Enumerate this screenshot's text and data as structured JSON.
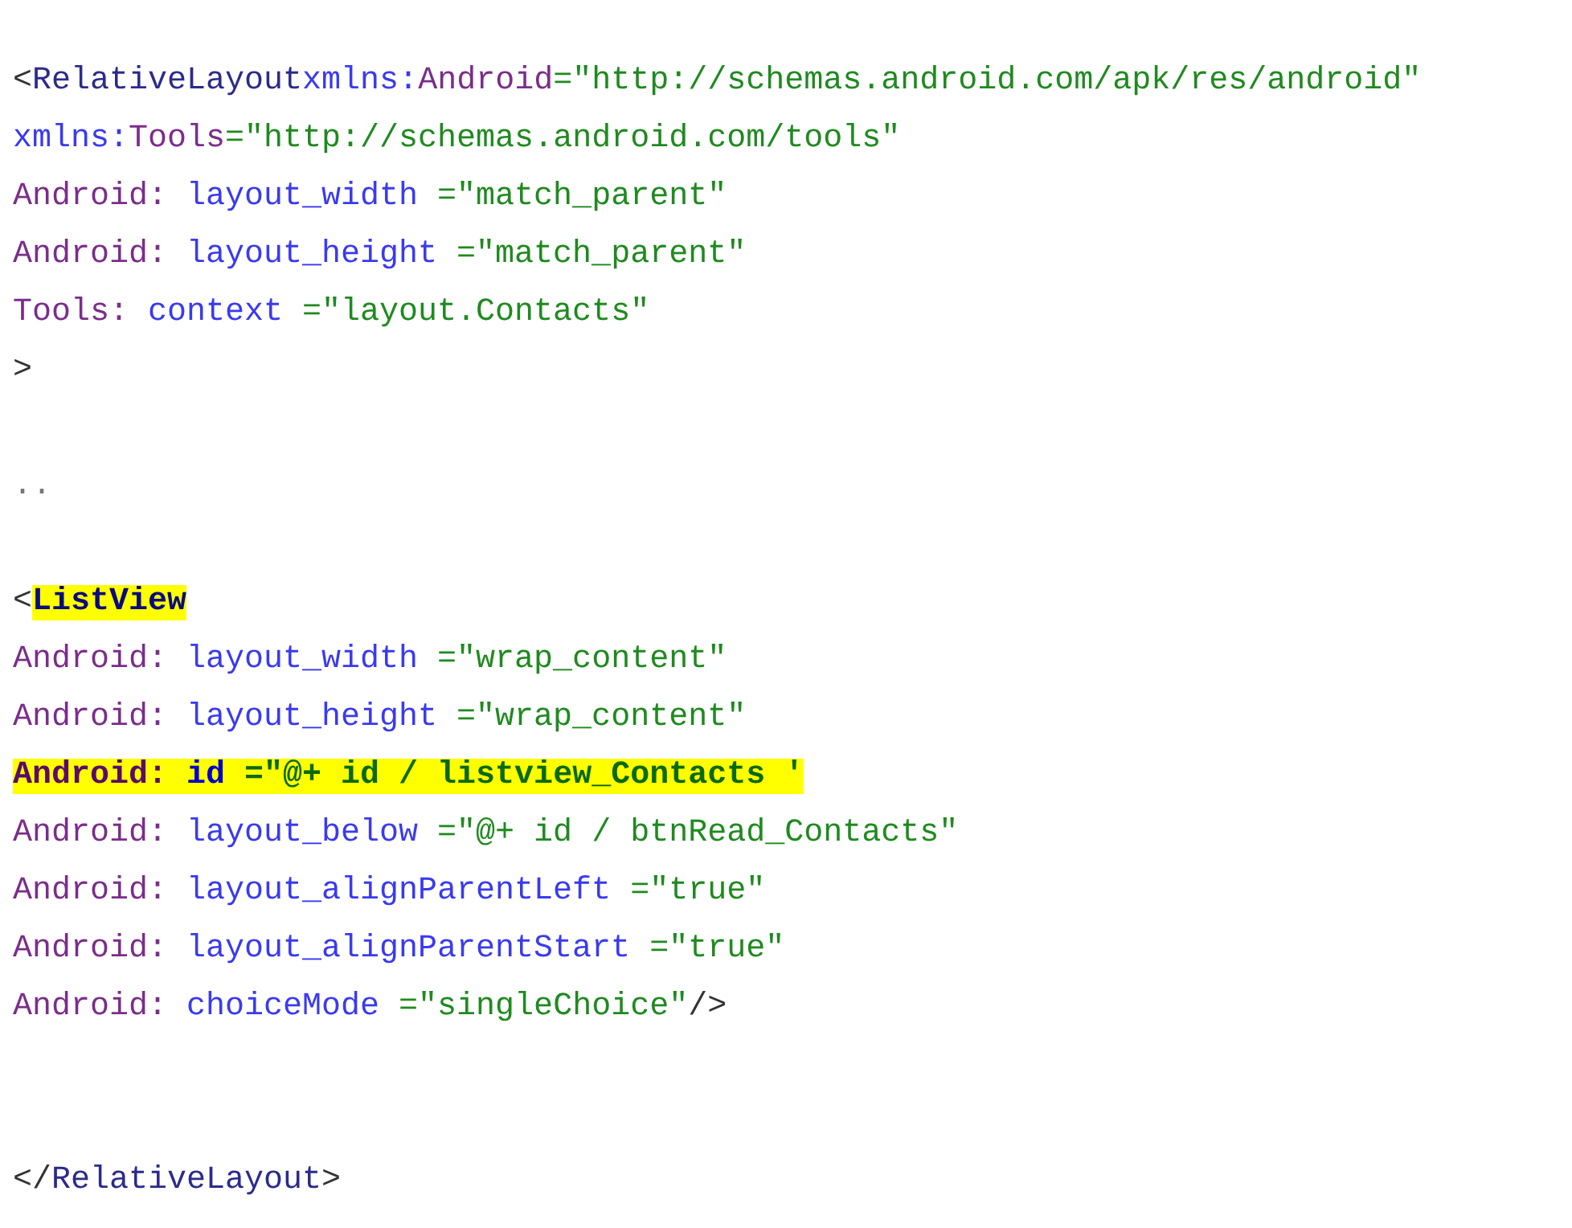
{
  "code_blocks": [
    {
      "lines": [
        {
          "tokens": [
            {
              "text": "<",
              "kind": "punct",
              "space_before": false,
              "highlighted": false
            },
            {
              "text": "RelativeLayout",
              "kind": "tag",
              "space_before": false,
              "highlighted": false
            },
            {
              "text": "xmlns:",
              "kind": "attr",
              "space_before": false,
              "highlighted": false
            },
            {
              "text": "Android",
              "kind": "prefix",
              "space_before": false,
              "highlighted": false
            },
            {
              "text": "=\"http://schemas.android.com/apk/res/android\"",
              "kind": "value",
              "space_before": false,
              "highlighted": false
            }
          ]
        },
        {
          "tokens": [
            {
              "text": "xmlns:",
              "kind": "attr",
              "space_before": false,
              "highlighted": false
            },
            {
              "text": "Tools",
              "kind": "prefix",
              "space_before": false,
              "highlighted": false
            },
            {
              "text": "=\"http://schemas.android.com/tools\"",
              "kind": "value",
              "space_before": false,
              "highlighted": false
            }
          ]
        },
        {
          "tokens": [
            {
              "text": "Android:",
              "kind": "prefix",
              "space_before": false,
              "highlighted": false
            },
            {
              "text": "layout_width",
              "kind": "attr",
              "space_before": true,
              "highlighted": false
            },
            {
              "text": "=\"match_parent\"",
              "kind": "value",
              "space_before": true,
              "highlighted": false
            }
          ]
        },
        {
          "tokens": [
            {
              "text": "Android:",
              "kind": "prefix",
              "space_before": false,
              "highlighted": false
            },
            {
              "text": "layout_height",
              "kind": "attr",
              "space_before": true,
              "highlighted": false
            },
            {
              "text": "=\"match_parent\"",
              "kind": "value",
              "space_before": true,
              "highlighted": false
            }
          ]
        },
        {
          "tokens": [
            {
              "text": "Tools:",
              "kind": "prefix",
              "space_before": false,
              "highlighted": false
            },
            {
              "text": "context",
              "kind": "attr",
              "space_before": true,
              "highlighted": false
            },
            {
              "text": "=\"layout.Contacts\"",
              "kind": "value",
              "space_before": true,
              "highlighted": false
            }
          ]
        },
        {
          "tokens": [
            {
              "text": ">",
              "kind": "punct",
              "space_before": false,
              "highlighted": false
            }
          ]
        }
      ]
    },
    {
      "lines": [
        {
          "tokens": [
            {
              "text": "..",
              "kind": "ellipsis",
              "space_before": false,
              "highlighted": false
            }
          ]
        }
      ]
    },
    {
      "lines": [
        {
          "tokens": [
            {
              "text": "<",
              "kind": "punct",
              "space_before": false,
              "highlighted": false
            },
            {
              "text": "ListView",
              "kind": "tag",
              "space_before": false,
              "highlighted": true
            }
          ]
        },
        {
          "tokens": [
            {
              "text": "Android:",
              "kind": "prefix",
              "space_before": false,
              "highlighted": false
            },
            {
              "text": "layout_width",
              "kind": "attr",
              "space_before": true,
              "highlighted": false
            },
            {
              "text": "=\"wrap_content\"",
              "kind": "value",
              "space_before": true,
              "highlighted": false
            }
          ]
        },
        {
          "tokens": [
            {
              "text": "Android:",
              "kind": "prefix",
              "space_before": false,
              "highlighted": false
            },
            {
              "text": "layout_height",
              "kind": "attr",
              "space_before": true,
              "highlighted": false
            },
            {
              "text": "=\"wrap_content\"",
              "kind": "value",
              "space_before": true,
              "highlighted": false
            }
          ]
        },
        {
          "tokens": [
            {
              "text": "Android:",
              "kind": "prefix",
              "space_before": false,
              "highlighted": true
            },
            {
              "text": "id",
              "kind": "attr",
              "space_before": true,
              "highlighted": true
            },
            {
              "text": "=\"@+ id / listview_Contacts '",
              "kind": "value",
              "space_before": true,
              "highlighted": true
            }
          ]
        },
        {
          "tokens": [
            {
              "text": "Android:",
              "kind": "prefix",
              "space_before": false,
              "highlighted": false
            },
            {
              "text": "layout_below",
              "kind": "attr",
              "space_before": true,
              "highlighted": false
            },
            {
              "text": "=\"@+ id / btnRead_Contacts\"",
              "kind": "value",
              "space_before": true,
              "highlighted": false
            }
          ]
        },
        {
          "tokens": [
            {
              "text": "Android:",
              "kind": "prefix",
              "space_before": false,
              "highlighted": false
            },
            {
              "text": "layout_alignParentLeft",
              "kind": "attr",
              "space_before": true,
              "highlighted": false
            },
            {
              "text": "=\"true\"",
              "kind": "value",
              "space_before": true,
              "highlighted": false
            }
          ]
        },
        {
          "tokens": [
            {
              "text": "Android:",
              "kind": "prefix",
              "space_before": false,
              "highlighted": false
            },
            {
              "text": "layout_alignParentStart",
              "kind": "attr",
              "space_before": true,
              "highlighted": false
            },
            {
              "text": "=\"true\"",
              "kind": "value",
              "space_before": true,
              "highlighted": false
            }
          ]
        },
        {
          "tokens": [
            {
              "text": "Android:",
              "kind": "prefix",
              "space_before": false,
              "highlighted": false
            },
            {
              "text": "choiceMode",
              "kind": "attr",
              "space_before": true,
              "highlighted": false
            },
            {
              "text": "=\"singleChoice\"",
              "kind": "value",
              "space_before": true,
              "highlighted": false
            },
            {
              "text": "/>",
              "kind": "punct",
              "space_before": false,
              "highlighted": false
            }
          ]
        }
      ]
    },
    {
      "lines": [
        {
          "tokens": [
            {
              "text": "</",
              "kind": "punct",
              "space_before": false,
              "highlighted": false
            },
            {
              "text": "RelativeLayout",
              "kind": "tag",
              "space_before": false,
              "highlighted": false
            },
            {
              "text": ">",
              "kind": "punct",
              "space_before": false,
              "highlighted": false
            }
          ]
        }
      ]
    }
  ]
}
